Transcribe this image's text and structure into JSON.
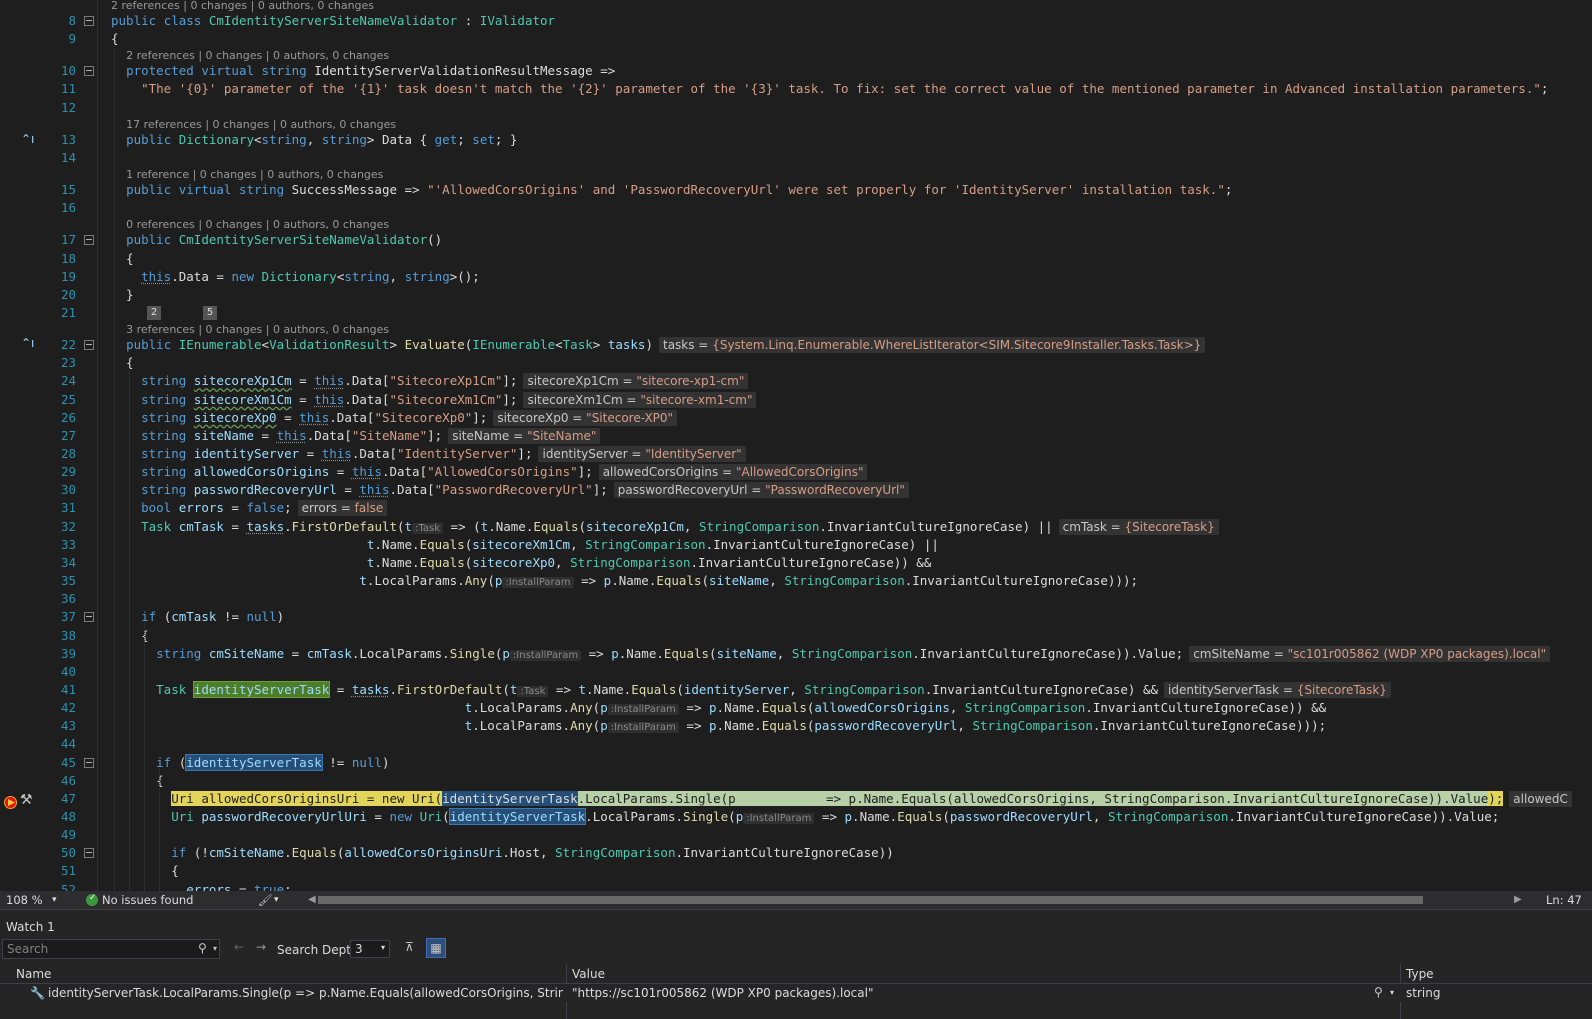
{
  "editor": {
    "lines": [
      {
        "n": "8",
        "lens": "2 references | 0 changes | 0 authors, 0 changes",
        "html": "<span class='k'>public</span> <span class='k'>class</span> <span class='t'>CmIdentityServerSiteNameValidator</span> : <span class='t'>IValidator</span>"
      },
      {
        "n": "9",
        "html": "{"
      },
      {
        "n": "10",
        "lens": "2 references | 0 changes | 0 authors, 0 changes",
        "html": "  <span class='k'>protected</span> <span class='k'>virtual</span> <span class='k'>string</span> IdentityServerValidationResultMessage =>"
      },
      {
        "n": "11",
        "html": "    <span class='s'>\"The '{0}' parameter of the '{1}' task doesn't match the '{2}' parameter of the '{3}' task. To fix: set the correct value of the mentioned parameter in Advanced installation parameters.\"</span>;"
      },
      {
        "n": "12",
        "html": ""
      },
      {
        "n": "13",
        "lens": "17 references | 0 changes | 0 authors, 0 changes",
        "html": "  <span class='k'>public</span> <span class='t'>Dictionary</span>&lt;<span class='k'>string</span>, <span class='k'>string</span>&gt; Data { <span class='k'>get</span>; <span class='k'>set</span>; }"
      },
      {
        "n": "14",
        "html": ""
      },
      {
        "n": "15",
        "lens": "1 reference | 0 changes | 0 authors, 0 changes",
        "html": "  <span class='k'>public</span> <span class='k'>virtual</span> <span class='k'>string</span> SuccessMessage => <span class='s'>\"'AllowedCorsOrigins' and 'PasswordRecoveryUrl' were set properly for 'IdentityServer' installation task.\"</span>;"
      },
      {
        "n": "16",
        "html": ""
      },
      {
        "n": "17",
        "lens": "0 references | 0 changes | 0 authors, 0 changes",
        "html": "  <span class='k'>public</span> <span class='t'>CmIdentityServerSiteNameValidator</span>()"
      },
      {
        "n": "18",
        "html": "  {"
      },
      {
        "n": "19",
        "html": "    <span class='k squigb'>this</span>.Data = <span class='k'>new</span> <span class='t'>Dictionary</span>&lt;<span class='k'>string</span>, <span class='k'>string</span>&gt;();"
      },
      {
        "n": "20",
        "html": "  }"
      },
      {
        "n": "21",
        "html": ""
      },
      {
        "n": "22",
        "lens": "3 references | 0 changes | 0 authors, 0 changes",
        "html": "  <span class='k'>public</span> <span class='t'>IEnumerable</span>&lt;<span class='t'>ValidationResult</span>&gt; <span class='m'>Evaluate</span>(<span class='t'>IEnumerable</span>&lt;<span class='t'>Task</span>&gt; <span class='i'>tasks</span>)<span class='dt'>tasks = <span class='dv'>{System.Linq.Enumerable.WhereListIterator&lt;SIM.Sitecore9Installer.Tasks.Task&gt;}</span></span>"
      },
      {
        "n": "23",
        "html": "  {"
      },
      {
        "n": "24",
        "html": "    <span class='k'>string</span> <span class='i squig'>sitecoreXp1Cm</span> = <span class='k squigb'>this</span>.Data[<span class='s'>\"SitecoreXp1Cm\"</span>];<span class='dt'>sitecoreXp1Cm = <span class='dv'>\"sitecore-xp1-cm\"</span></span>"
      },
      {
        "n": "25",
        "html": "    <span class='k'>string</span> <span class='i squig'>sitecoreXm1Cm</span> = <span class='k squigb'>this</span>.Data[<span class='s'>\"SitecoreXm1Cm\"</span>];<span class='dt'>sitecoreXm1Cm = <span class='dv'>\"sitecore-xm1-cm\"</span></span>"
      },
      {
        "n": "26",
        "html": "    <span class='k'>string</span> <span class='i squig'>sitecoreXp0</span> = <span class='k squigb'>this</span>.Data[<span class='s'>\"SitecoreXp0\"</span>];<span class='dt'>sitecoreXp0 = <span class='dv'>\"Sitecore-XP0\"</span></span>"
      },
      {
        "n": "27",
        "html": "    <span class='k'>string</span> <span class='i'>siteName</span> = <span class='k squigb'>this</span>.Data[<span class='s'>\"SiteName\"</span>];<span class='dt'>siteName = <span class='dv'>\"SiteName\"</span></span>"
      },
      {
        "n": "28",
        "html": "    <span class='k'>string</span> <span class='i'>identityServer</span> = <span class='k squigb'>this</span>.Data[<span class='s'>\"IdentityServer\"</span>];<span class='dt'>identityServer = <span class='dv'>\"IdentityServer\"</span></span>"
      },
      {
        "n": "29",
        "html": "    <span class='k'>string</span> <span class='i'>allowedCorsOrigins</span> = <span class='k squigb'>this</span>.Data[<span class='s'>\"AllowedCorsOrigins\"</span>];<span class='dt'>allowedCorsOrigins = <span class='dv'>\"AllowedCorsOrigins\"</span></span>"
      },
      {
        "n": "30",
        "html": "    <span class='k'>string</span> <span class='i'>passwordRecoveryUrl</span> = <span class='k squigb'>this</span>.Data[<span class='s'>\"PasswordRecoveryUrl\"</span>];<span class='dt'>passwordRecoveryUrl = <span class='dv'>\"PasswordRecoveryUrl\"</span></span>"
      },
      {
        "n": "31",
        "html": "    <span class='k'>bool</span> <span class='i'>errors</span> = <span class='k'>false</span>;<span class='dt'>errors = <span class='dv'>false</span></span>"
      },
      {
        "n": "32",
        "html": "    <span class='t'>Task</span> <span class='i'>cmTask</span> = <span class='i squigb'>tasks</span>.<span class='m'>FirstOrDefault</span>(<span class='i'>t</span><span class='hint'>:Task</span> => (<span class='i'>t</span>.Name.<span class='m'>Equals</span>(<span class='i'>sitecoreXp1Cm</span>, <span class='t'>StringComparison</span>.InvariantCultureIgnoreCase) ||<span class='dt'>cmTask = <span class='dv'>{SitecoreTask}</span></span>"
      },
      {
        "n": "33",
        "html": "                                  <span class='i'>t</span>.Name.<span class='m'>Equals</span>(<span class='i'>sitecoreXm1Cm</span>, <span class='t'>StringComparison</span>.InvariantCultureIgnoreCase) ||"
      },
      {
        "n": "34",
        "html": "                                  <span class='i'>t</span>.Name.<span class='m'>Equals</span>(<span class='i'>sitecoreXp0</span>, <span class='t'>StringComparison</span>.InvariantCultureIgnoreCase)) &&"
      },
      {
        "n": "35",
        "html": "                                 <span class='i'>t</span>.LocalParams.<span class='m'>Any</span>(<span class='i'>p</span><span class='hint'>:InstallParam</span> => <span class='i'>p</span>.Name.<span class='m'>Equals</span>(<span class='i'>siteName</span>, <span class='t'>StringComparison</span>.InvariantCultureIgnoreCase)));"
      },
      {
        "n": "36",
        "html": ""
      },
      {
        "n": "37",
        "html": "    <span class='k'>if</span> (<span class='i'>cmTask</span> != <span class='k'>null</span>)"
      },
      {
        "n": "38",
        "html": "    {"
      },
      {
        "n": "39",
        "html": "      <span class='k'>string</span> <span class='i'>cmSiteName</span> = <span class='i'>cmTask</span>.LocalParams.<span class='m'>Single</span>(<span class='i'>p</span><span class='hint'>:InstallParam</span> => <span class='i'>p</span>.Name.<span class='m'>Equals</span>(<span class='i'>siteName</span>, <span class='t'>StringComparison</span>.InvariantCultureIgnoreCase)).Value;<span class='dt'>cmSiteName = <span class='dv'>\"sc101r005862 (WDP XP0 packages).local\"</span></span>"
      },
      {
        "n": "40",
        "html": ""
      },
      {
        "n": "41",
        "html": "      <span class='t'>Task</span> <span class='i hl-green'>identityServerTask</span> = <span class='i squigb'>tasks</span>.<span class='m'>FirstOrDefault</span>(<span class='i'>t</span><span class='hint'>:Task</span> => <span class='i'>t</span>.Name.<span class='m'>Equals</span>(<span class='i'>identityServer</span>, <span class='t'>StringComparison</span>.InvariantCultureIgnoreCase) &&<span class='dt'>identityServerTask = <span class='dv'>{SitecoreTask}</span></span>"
      },
      {
        "n": "42",
        "html": "                                               <span class='i'>t</span>.LocalParams.<span class='m'>Any</span>(<span class='i'>p</span><span class='hint'>:InstallParam</span> => <span class='i'>p</span>.Name.<span class='m'>Equals</span>(<span class='i'>allowedCorsOrigins</span>, <span class='t'>StringComparison</span>.InvariantCultureIgnoreCase)) &&"
      },
      {
        "n": "43",
        "html": "                                               <span class='i'>t</span>.LocalParams.<span class='m'>Any</span>(<span class='i'>p</span><span class='hint'>:InstallParam</span> => <span class='i'>p</span>.Name.<span class='m'>Equals</span>(<span class='i'>passwordRecoveryUrl</span>, <span class='t'>StringComparison</span>.InvariantCultureIgnoreCase)));"
      },
      {
        "n": "44",
        "html": ""
      },
      {
        "n": "45",
        "html": "      <span class='k'>if</span> (<span class='i hl-blue'>identityServerTask</span> != <span class='k'>null</span>)"
      },
      {
        "n": "46",
        "html": "      {"
      },
      {
        "n": "47",
        "cur": true,
        "html": "        <span style='background:#e3d55a;color:#1e1e1e'>Uri allowedCorsOriginsUri = new Uri(</span><span style='background:#264f78;color:#dcdcdc'>identityServerTask</span><span style='background:#b7d0a8;color:#1e1e1e'>.LocalParams.Single(p            => p.Name.Equals(allowedCorsOrigins, StringComparison.InvariantCultureIgnoreCase)).Value</span><span style='background:#e3d55a;color:#1e1e1e'>);</span><span class='dt'>allowedC</span>"
      },
      {
        "n": "48",
        "html": "        <span class='t'>Uri</span> <span class='i'>passwordRecoveryUrlUri</span> = <span class='k'>new</span> <span class='t'>Uri</span>(<span class='i hl-blue'>identityServerTask</span>.LocalParams.<span class='m'>Single</span>(<span class='i'>p</span><span class='hint'>:InstallParam</span> => <span class='i'>p</span>.Name.<span class='m'>Equals</span>(<span class='i'>passwordRecoveryUrl</span>, <span class='t'>StringComparison</span>.InvariantCultureIgnoreCase)).Value;"
      },
      {
        "n": "49",
        "html": ""
      },
      {
        "n": "50",
        "html": "        <span class='k'>if</span> (!<span class='i'>cmSiteName</span>.<span class='m'>Equals</span>(<span class='i'>allowedCorsOriginsUri</span>.Host, <span class='t'>StringComparison</span>.InvariantCultureIgnoreCase))"
      },
      {
        "n": "51",
        "html": "        {"
      },
      {
        "n": "52",
        "html": "          <span class='i'>errors</span> = <span class='k'>true</span>;"
      }
    ]
  },
  "folds": [
    "8",
    "10",
    "17",
    "22",
    "37",
    "45",
    "50"
  ],
  "badges": [
    "2",
    "5"
  ],
  "status": {
    "zoom": "108 %",
    "issues": "No issues found",
    "line_col": "Ln: 47"
  },
  "watch": {
    "title": "Watch 1",
    "search_placeholder": "Search",
    "search_depth_label": "Search Depth:",
    "search_depth_value": "3",
    "columns": {
      "name": "Name",
      "value": "Value",
      "type": "Type"
    },
    "row": {
      "name": "identityServerTask.LocalParams.Single(p => p.Name.Equals(allowedCorsOrigins, StringCompariso...",
      "value": "\"https://sc101r005862 (WDP XP0 packages).local\"",
      "type": "string"
    }
  }
}
